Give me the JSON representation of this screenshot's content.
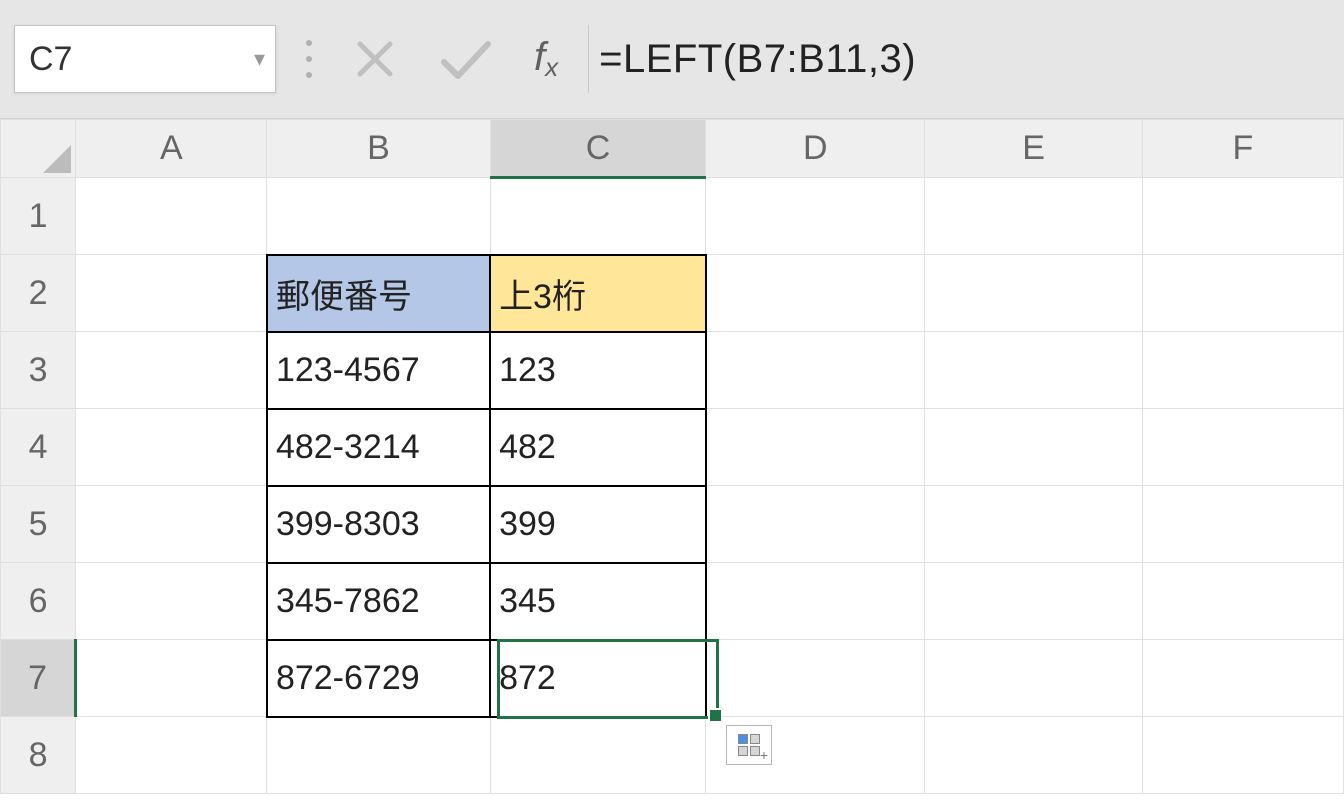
{
  "name_box": "C7",
  "formula": "=LEFT(B7:B11,3)",
  "columns": [
    "A",
    "B",
    "C",
    "D",
    "E",
    "F"
  ],
  "rows": [
    "1",
    "2",
    "3",
    "4",
    "5",
    "6",
    "7",
    "8"
  ],
  "selected_column": "C",
  "selected_row": "7",
  "data_headers": {
    "b2": "郵便番号",
    "c2": "上3桁"
  },
  "data_rows": [
    {
      "b": "123-4567",
      "c": "123"
    },
    {
      "b": "482-3214",
      "c": "482"
    },
    {
      "b": "399-8303",
      "c": "399"
    },
    {
      "b": "345-7862",
      "c": "345"
    },
    {
      "b": "872-6729",
      "c": "872"
    }
  ]
}
